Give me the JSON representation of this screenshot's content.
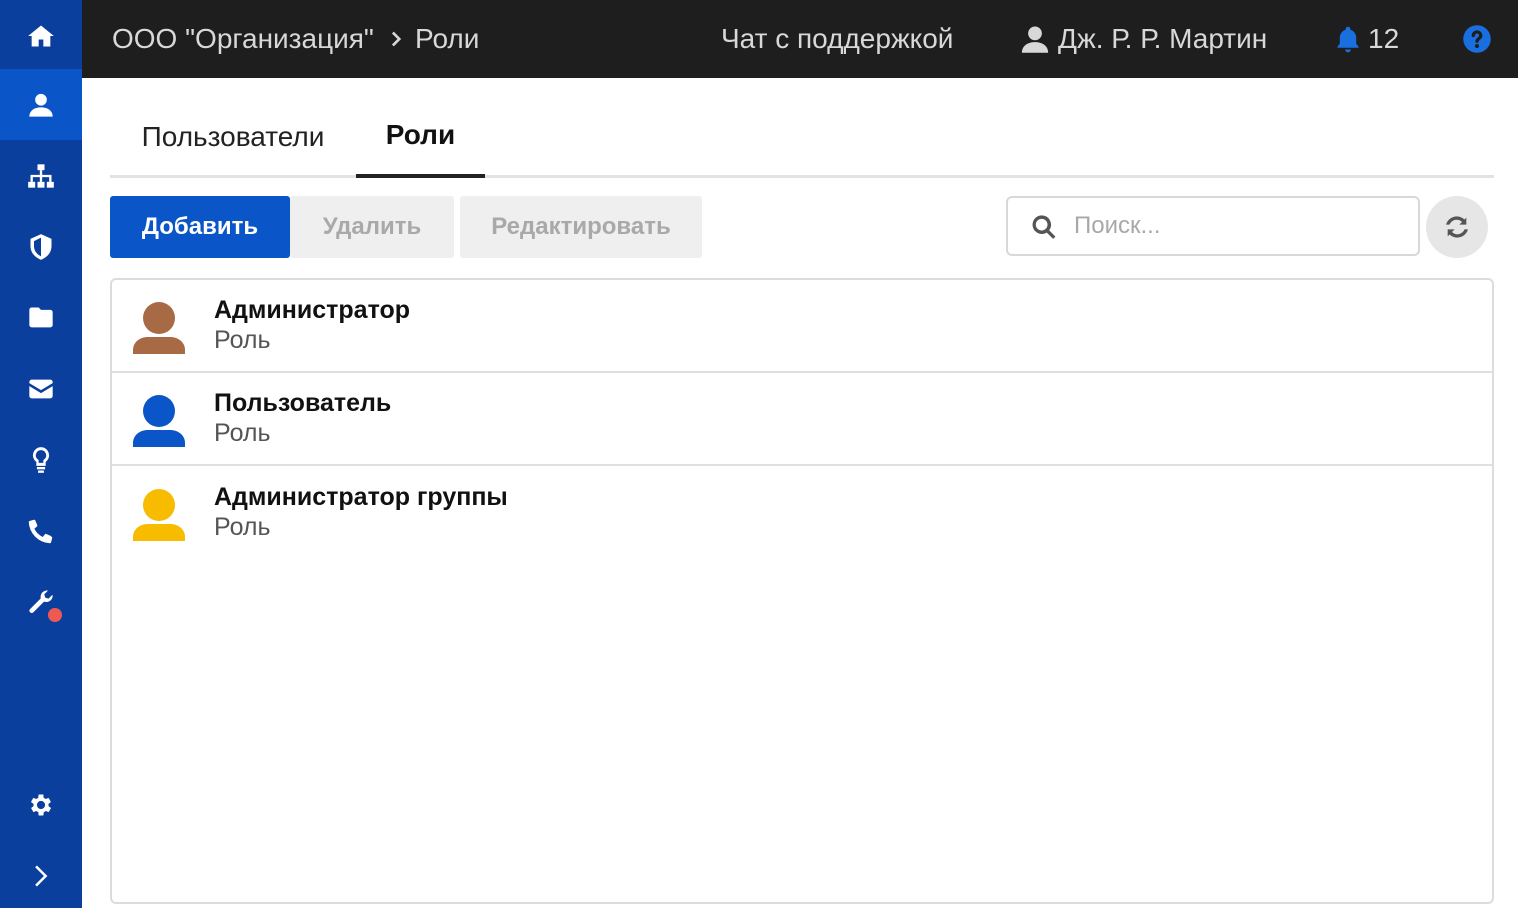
{
  "sidebar": {
    "items": [
      {
        "name": "home-icon",
        "active": false
      },
      {
        "name": "user-icon",
        "active": true
      },
      {
        "name": "sitemap-icon",
        "active": false
      },
      {
        "name": "shield-icon",
        "active": false
      },
      {
        "name": "folder-icon",
        "active": false
      },
      {
        "name": "envelope-icon",
        "active": false
      },
      {
        "name": "lightbulb-icon",
        "active": false
      },
      {
        "name": "phone-icon",
        "active": false
      },
      {
        "name": "wrench-icon",
        "active": false,
        "notification": true
      },
      {
        "name": "gear-icon",
        "active": false
      },
      {
        "name": "chevron-right-icon",
        "active": false
      }
    ],
    "color": "#0b3f9e",
    "active_color": "#0a56c8"
  },
  "header": {
    "breadcrumb": {
      "organization": "ООО \"Организация\"",
      "current": "Роли"
    },
    "support_chat": "Чат с поддержкой",
    "user_name": "Дж. Р. Р. Мартин",
    "notifications_count": "12",
    "icons": {
      "user": "user-icon",
      "bell": "bell-icon",
      "help": "question-circle-icon"
    },
    "accent_color": "#0a56c8"
  },
  "tabs": [
    {
      "label": "Пользователи",
      "active": false
    },
    {
      "label": "Роли",
      "active": true
    }
  ],
  "toolbar": {
    "add_label": "Добавить",
    "delete_label": "Удалить",
    "edit_label": "Редактировать",
    "search_placeholder": "Поиск...",
    "search_icon": "search-icon",
    "refresh_icon": "refresh-icon"
  },
  "roles": [
    {
      "title": "Администратор",
      "subtitle": "Роль",
      "avatar_color": "#a86a45"
    },
    {
      "title": "Пользователь",
      "subtitle": "Роль",
      "avatar_color": "#0a56c8"
    },
    {
      "title": "Администратор группы",
      "subtitle": "Роль",
      "avatar_color": "#f7bc00"
    }
  ]
}
